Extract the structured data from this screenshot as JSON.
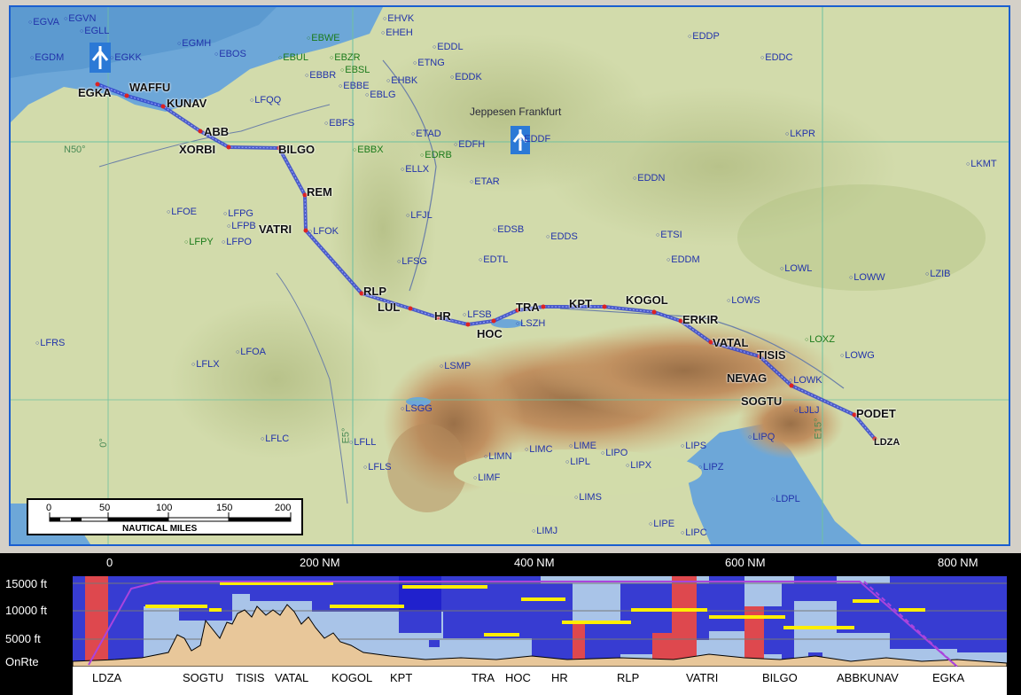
{
  "map": {
    "watermark": "Jeppesen Frankfurt",
    "graticule": [
      "N50°",
      "E5°",
      "E15°",
      "0°"
    ],
    "route_waypoints": [
      {
        "id": "wp-egka",
        "label": "EGKA"
      },
      {
        "id": "wp-waffu",
        "label": "WAFFU"
      },
      {
        "id": "wp-kunav",
        "label": "KUNAV"
      },
      {
        "id": "wp-abb",
        "label": "ABB"
      },
      {
        "id": "wp-xorbi",
        "label": "XORBI"
      },
      {
        "id": "wp-bilgo",
        "label": "BILGO"
      },
      {
        "id": "wp-rem",
        "label": "REM"
      },
      {
        "id": "wp-vatri",
        "label": "VATRI"
      },
      {
        "id": "wp-rlp",
        "label": "RLP"
      },
      {
        "id": "wp-lul",
        "label": "LUL"
      },
      {
        "id": "wp-hr",
        "label": "HR"
      },
      {
        "id": "wp-hoc",
        "label": "HOC"
      },
      {
        "id": "wp-tra",
        "label": "TRA"
      },
      {
        "id": "wp-kpt",
        "label": "KPT"
      },
      {
        "id": "wp-kogol",
        "label": "KOGOL"
      },
      {
        "id": "wp-erkir",
        "label": "ERKIR"
      },
      {
        "id": "wp-vatal",
        "label": "VATAL"
      },
      {
        "id": "wp-tisis",
        "label": "TISIS"
      },
      {
        "id": "wp-nevag",
        "label": "NEVAG"
      },
      {
        "id": "wp-sogtu",
        "label": "SOGTU"
      },
      {
        "id": "wp-podet",
        "label": "PODET"
      },
      {
        "id": "wp-ldza",
        "label": "LDZA"
      }
    ],
    "airports": [
      "EGVA",
      "EGVN",
      "EGLL",
      "EGDM",
      "EGKK",
      "EGMH",
      "EBOS",
      "EBWE",
      "EHEH",
      "EHVK",
      "EDDL",
      "EDDP",
      "EBUL",
      "EBZR",
      "EBBR",
      "EBSL",
      "ETNG",
      "EDDC",
      "EBBE",
      "EBLG",
      "EHBK",
      "EDDK",
      "LFQQ",
      "EBFS",
      "ETAD",
      "EDFH",
      "EDDF",
      "EBBX",
      "EDRB",
      "ELLX",
      "LKPR",
      "LKMT",
      "ETAR",
      "EDDN",
      "LFOE",
      "LFPG",
      "LFPB",
      "LFJL",
      "LFPY",
      "LFPO",
      "LFOK",
      "EDSB",
      "EDDS",
      "ETSI",
      "EDDM",
      "LFSG",
      "EDTL",
      "LOWL",
      "LOWW",
      "LZIB",
      "LFSB",
      "LOWS",
      "LSZH",
      "LFRS",
      "LFOA",
      "LOXZ",
      "LFLX",
      "LSMP",
      "LOWG",
      "LOWK",
      "LSGG",
      "LJLJ",
      "LFLC",
      "LFLL",
      "LIMC",
      "LIME",
      "LIPO",
      "LIPS",
      "LIPQ",
      "LIMN",
      "LIPL",
      "LIPX",
      "LFLS",
      "LIPZ",
      "LIMF",
      "LDPL",
      "LIMS",
      "LIPE",
      "LIMJ",
      "LIPC"
    ],
    "scale": {
      "ticks": [
        "0",
        "50",
        "100",
        "150",
        "200"
      ],
      "label": "NAUTICAL MILES"
    }
  },
  "profile": {
    "distance_labels": [
      "0",
      "200 NM",
      "400 NM",
      "600 NM",
      "800 NM"
    ],
    "altitude_labels": [
      "15000 ft",
      "10000 ft",
      "5000 ft",
      "OnRte"
    ],
    "fix_labels": [
      "LDZA",
      "SOGTU",
      "TISIS",
      "VATAL",
      "KOGOL",
      "KPT",
      "TRA",
      "HOC",
      "HR",
      "RLP",
      "VATRI",
      "BILGO",
      "ABBKUNAV",
      "EGKA"
    ]
  },
  "colors": {
    "route": "#3344cc",
    "route_node": "#dd2222",
    "frame": "#1a5fd0",
    "sea": "#6da7d8",
    "airspace_blue": "#1a1acc",
    "airspace_red": "#e83333",
    "profile_sky": "#a9c4e8",
    "flight_level": "#ffee00",
    "profile_path": "#aa44dd"
  }
}
